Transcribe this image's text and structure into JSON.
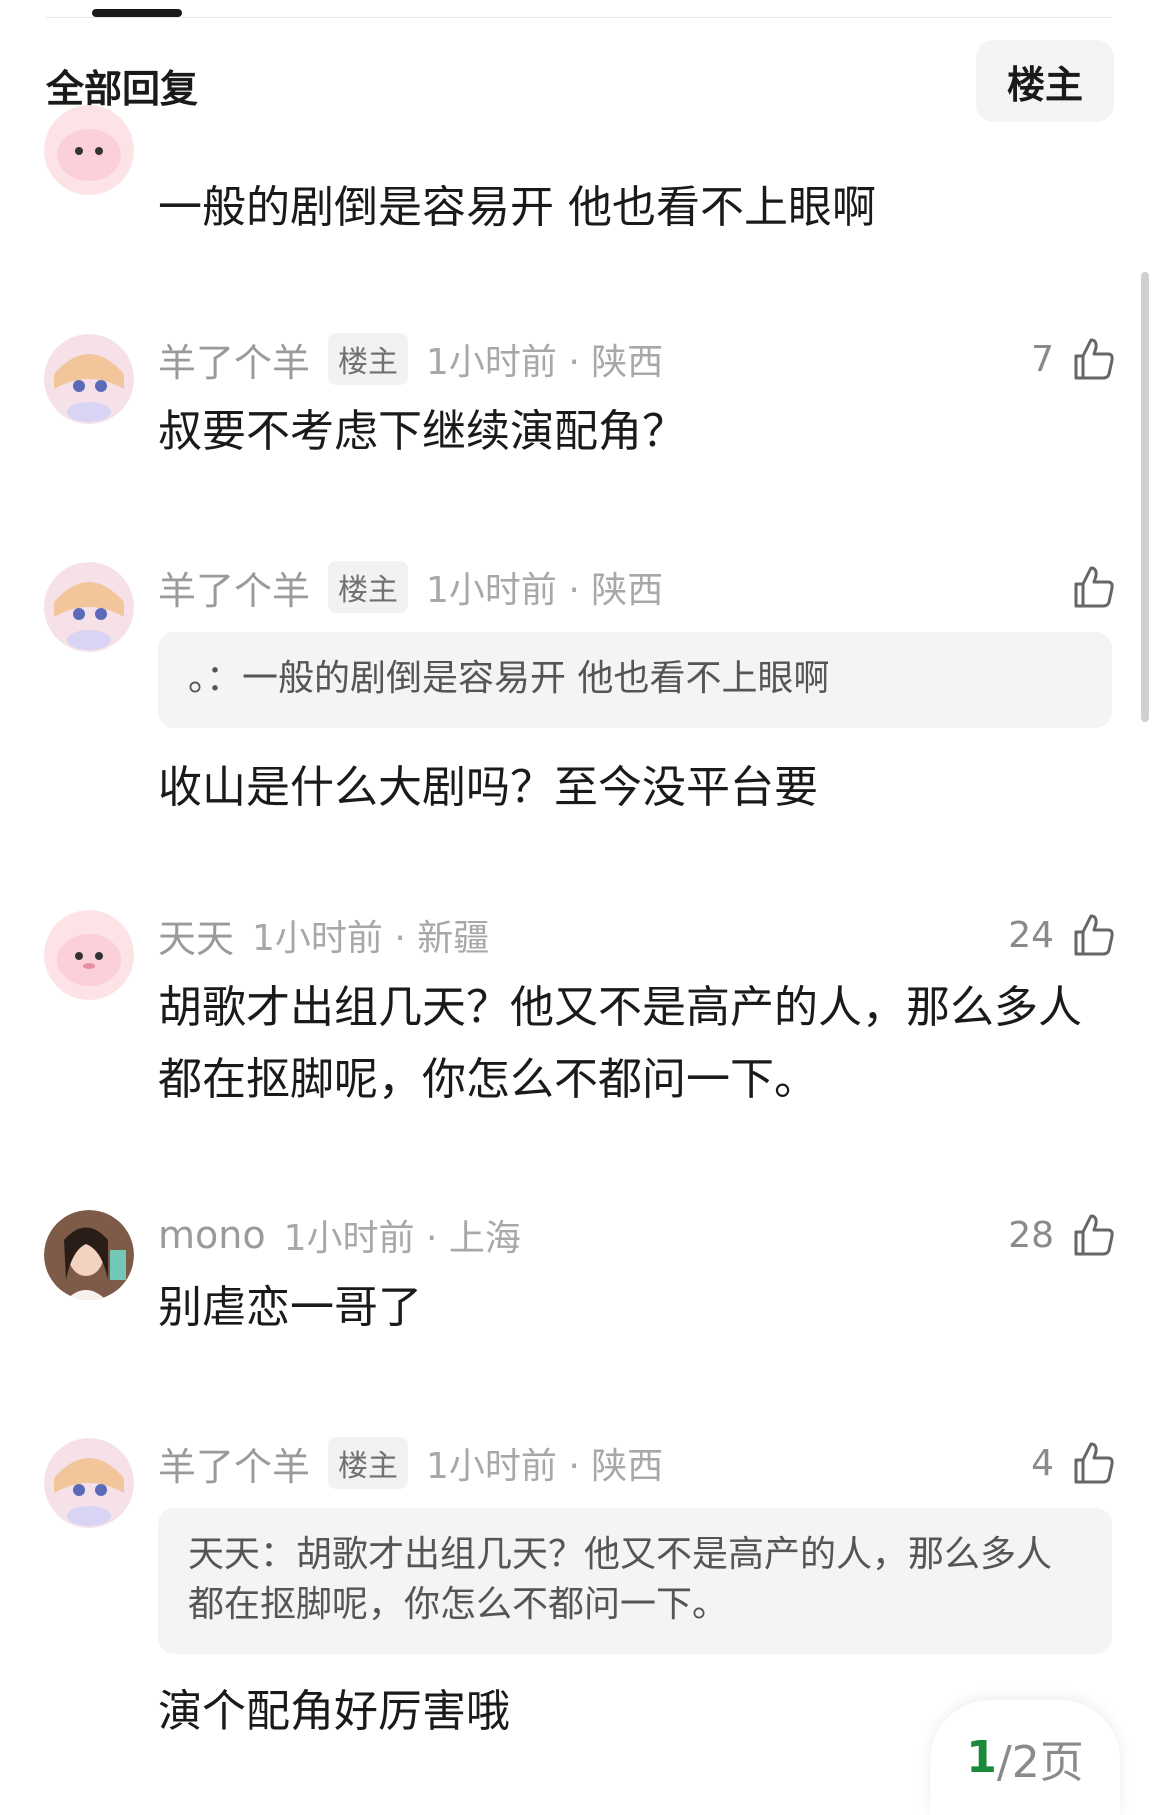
{
  "header": {
    "title": "全部回复",
    "filter_label": "楼主"
  },
  "comments": [
    {
      "id": "c0",
      "text": "一般的剧倒是容易开 他也看不上眼啊"
    },
    {
      "id": "c1",
      "name": "羊了个羊",
      "owner_tag": "楼主",
      "time": "1小时前 · 陕西",
      "likes": "7",
      "text": "叔要不考虑下继续演配角？"
    },
    {
      "id": "c2",
      "name": "羊了个羊",
      "owner_tag": "楼主",
      "time": "1小时前 · 陕西",
      "likes": "",
      "quote": "。：一般的剧倒是容易开 他也看不上眼啊",
      "text": "收山是什么大剧吗？至今没平台要"
    },
    {
      "id": "c3",
      "name": "天天",
      "time": "1小时前 · 新疆",
      "likes": "24",
      "text": "胡歌才出组几天？他又不是高产的人，那么多人都在抠脚呢，你怎么不都问一下。"
    },
    {
      "id": "c4",
      "name": "mono",
      "time": "1小时前 · 上海",
      "likes": "28",
      "text": "别虐恋一哥了"
    },
    {
      "id": "c5",
      "name": "羊了个羊",
      "owner_tag": "楼主",
      "time": "1小时前 · 陕西",
      "likes": "4",
      "quote": "天天：胡歌才出组几天？他又不是高产的人，那么多人都在抠脚呢，你怎么不都问一下。",
      "text": "演个配角好厉害哦"
    }
  ],
  "pager": {
    "current": "1",
    "rest": "/2页"
  },
  "icons": {
    "like": "thumbs-up-icon"
  },
  "colors": {
    "pager_current": "#1a8a3a",
    "meta_gray": "#9a9a9a"
  }
}
